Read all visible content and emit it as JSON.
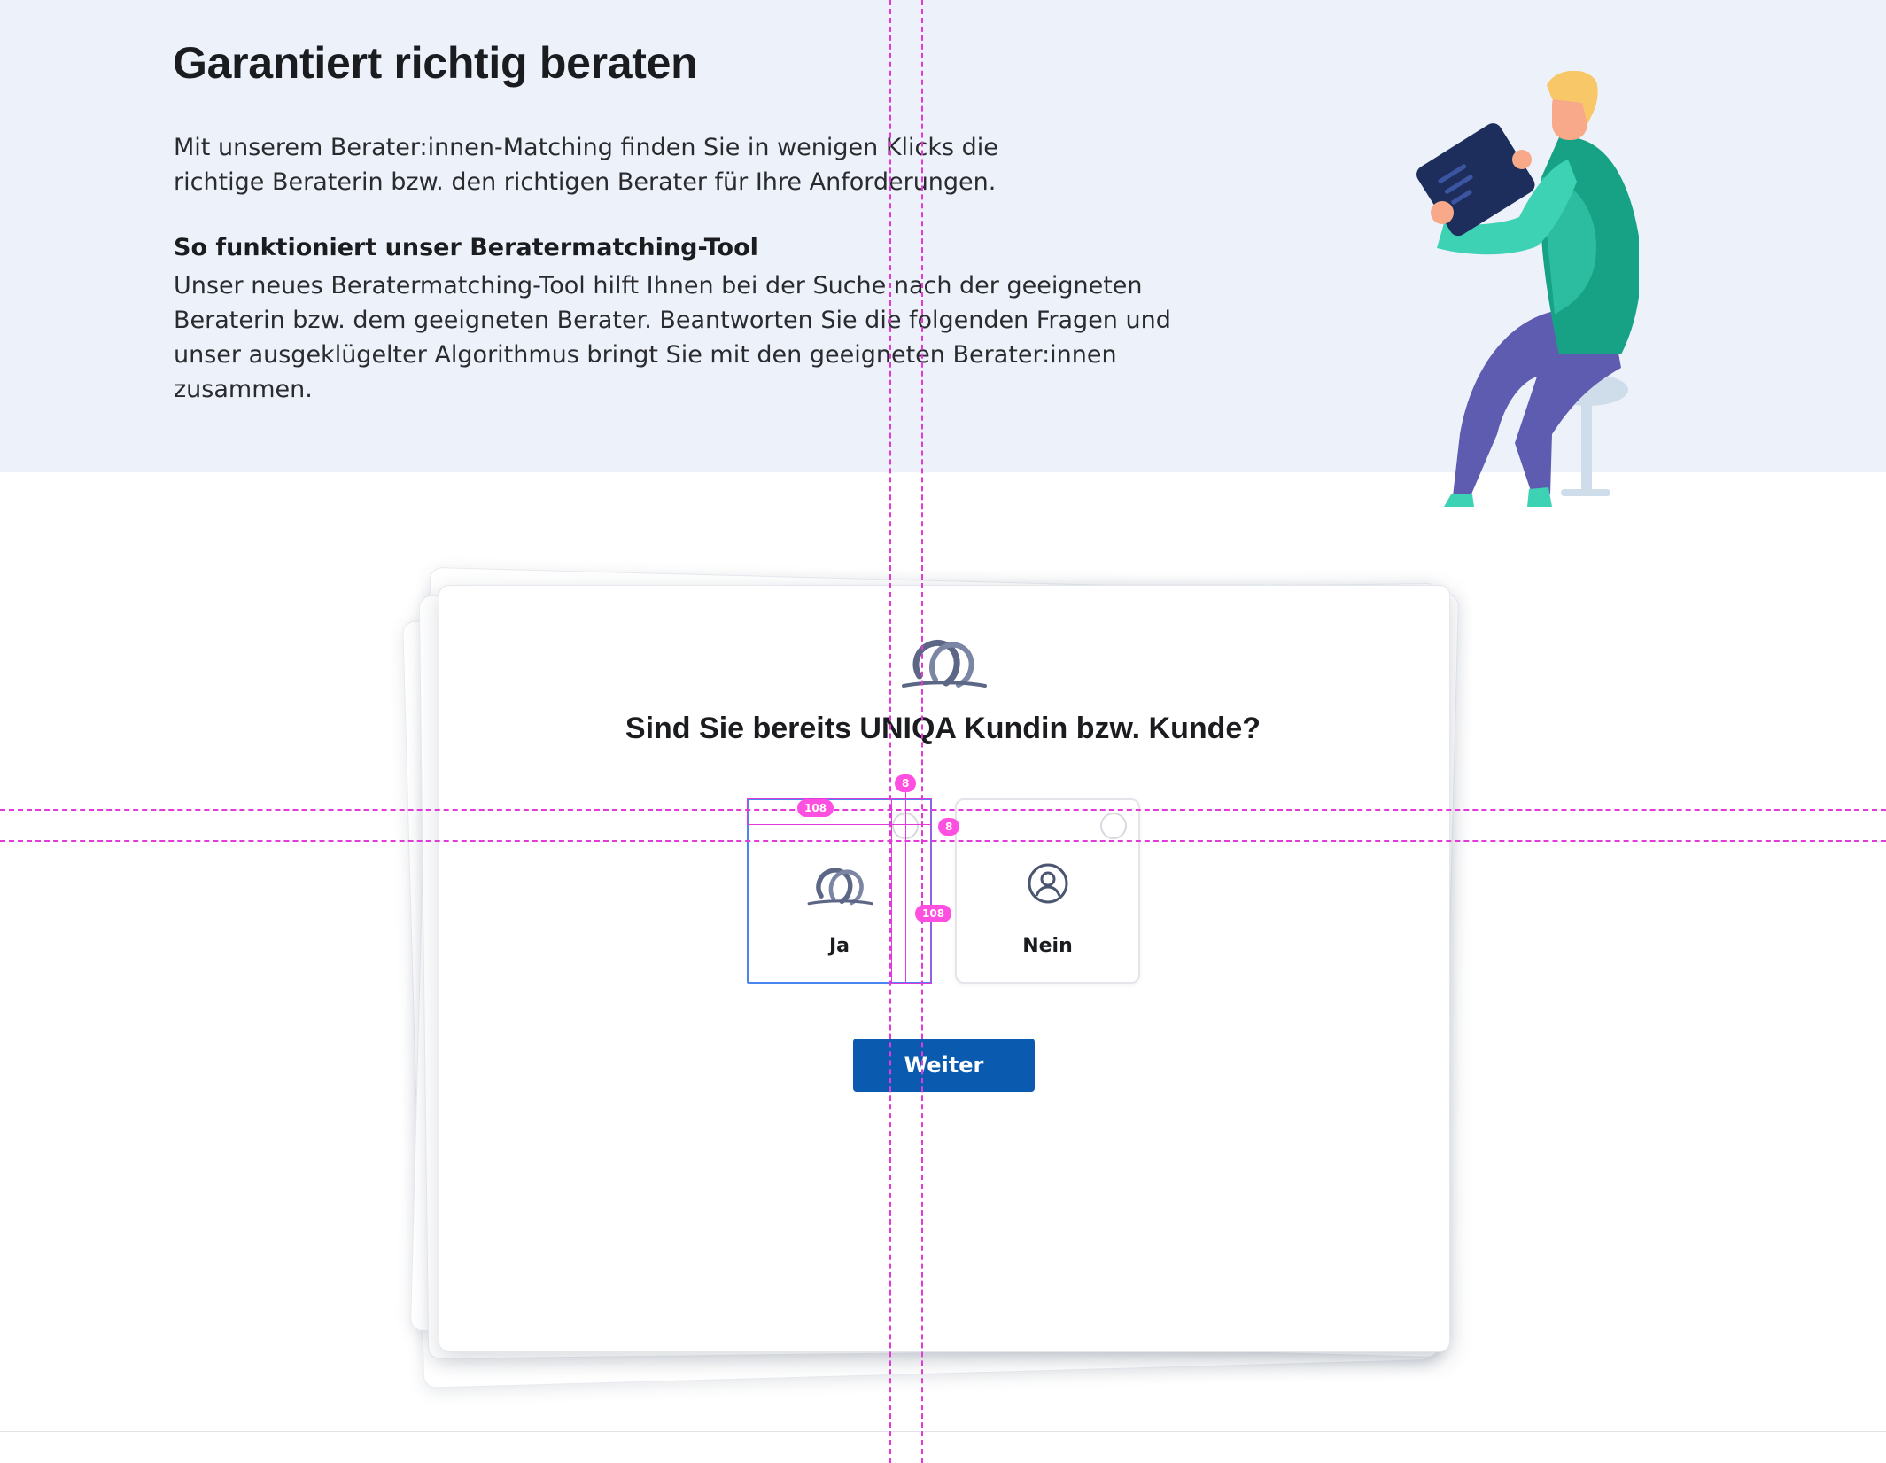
{
  "hero": {
    "title": "Garantiert richtig beraten",
    "intro": "Mit unserem Berater:innen-Matching finden Sie in wenigen Klicks die richtige Beraterin bzw. den richtigen Berater für Ihre Anforderungen.",
    "subtitle": "So funktioniert unser Beratermatching-Tool",
    "body": "Unser neues Beratermatching-Tool hilft Ihnen bei der Suche nach der geeigneten Beraterin bzw. dem geeigneten Berater. Beantworten Sie die folgenden Fragen und unser ausgeklügelter Algorithmus bringt Sie mit den geeigneten Berater:innen zusammen."
  },
  "card": {
    "logo": "uniqa-logo-icon",
    "question": "Sind Sie bereits UNIQA Kundin bzw. Kunde?",
    "options": [
      {
        "label": "Ja",
        "icon": "uniqa-logo-icon",
        "selected": true
      },
      {
        "label": "Nein",
        "icon": "user-icon",
        "selected": false
      }
    ],
    "next_button": "Weiter"
  },
  "spec_overlay": {
    "labels": [
      "108",
      "8",
      "8",
      "108"
    ]
  },
  "colors": {
    "hero_background": "#edf2fa",
    "primary_button": "#0a5bb0",
    "selection_outline": "#4a86f0",
    "guide": "#e23ad9"
  }
}
